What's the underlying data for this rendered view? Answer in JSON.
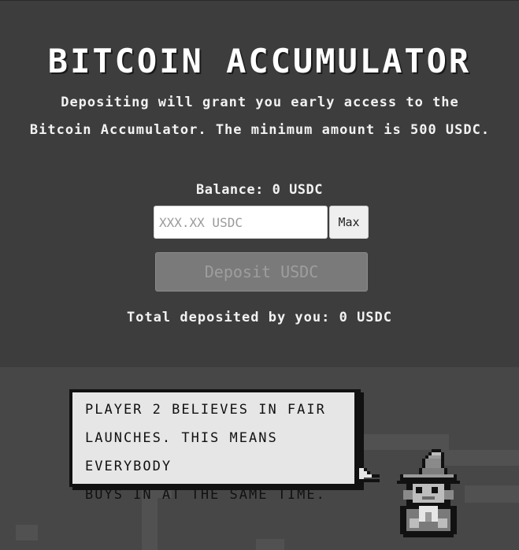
{
  "header": {
    "title": "BITCOIN ACCUMULATOR",
    "description_line1": "Depositing will grant you early access to the",
    "description_line2": "Bitcoin Accumulator. The minimum amount is 500 USDC."
  },
  "deposit_form": {
    "balance_label": "Balance: 0 USDC",
    "amount_placeholder": "XXX.XX USDC",
    "max_label": "Max",
    "deposit_label": "Deposit USDC",
    "total_deposited": "Total deposited by you: 0 USDC"
  },
  "speech": {
    "line1": "PLAYER 2 BELIEVES IN FAIR",
    "line2": "LAUNCHES. THIS MEANS EVERYBODY",
    "line3": "BUYS IN AT THE SAME TIME."
  },
  "icons": {
    "character": "wizard-icon"
  },
  "colors": {
    "background_top": "#3d3d3d",
    "background_bottom": "#474747",
    "bubble": "#e6e6e6",
    "deposit_disabled": "#7a7a7a"
  }
}
